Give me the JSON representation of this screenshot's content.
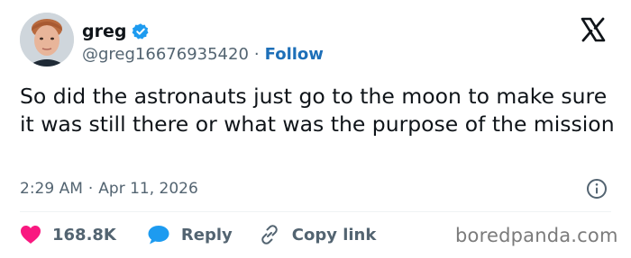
{
  "author": {
    "display_name": "greg",
    "handle": "@greg16676935420",
    "separator": "·",
    "follow_label": "Follow"
  },
  "tweet": {
    "text": "So did the astronauts just go to the moon to make sure it was still there or what was the purpose of the mission",
    "time": "2:29 AM",
    "separator": "·",
    "date": "Apr 11, 2026"
  },
  "actions": {
    "like_count": "168.8K",
    "reply_label": "Reply",
    "copy_link_label": "Copy link"
  },
  "watermark": "boredpanda.com",
  "colors": {
    "verified": "#1d9bf0",
    "follow_link": "#1d6fb8",
    "like_heart": "#f91880",
    "reply_bubble": "#1d9bf0",
    "secondary_text": "#536471"
  },
  "icons": {
    "verified": "verified-badge-icon",
    "logo": "x-logo-icon",
    "info": "info-icon",
    "like": "heart-icon",
    "reply": "reply-bubble-icon",
    "copy_link": "link-icon"
  }
}
